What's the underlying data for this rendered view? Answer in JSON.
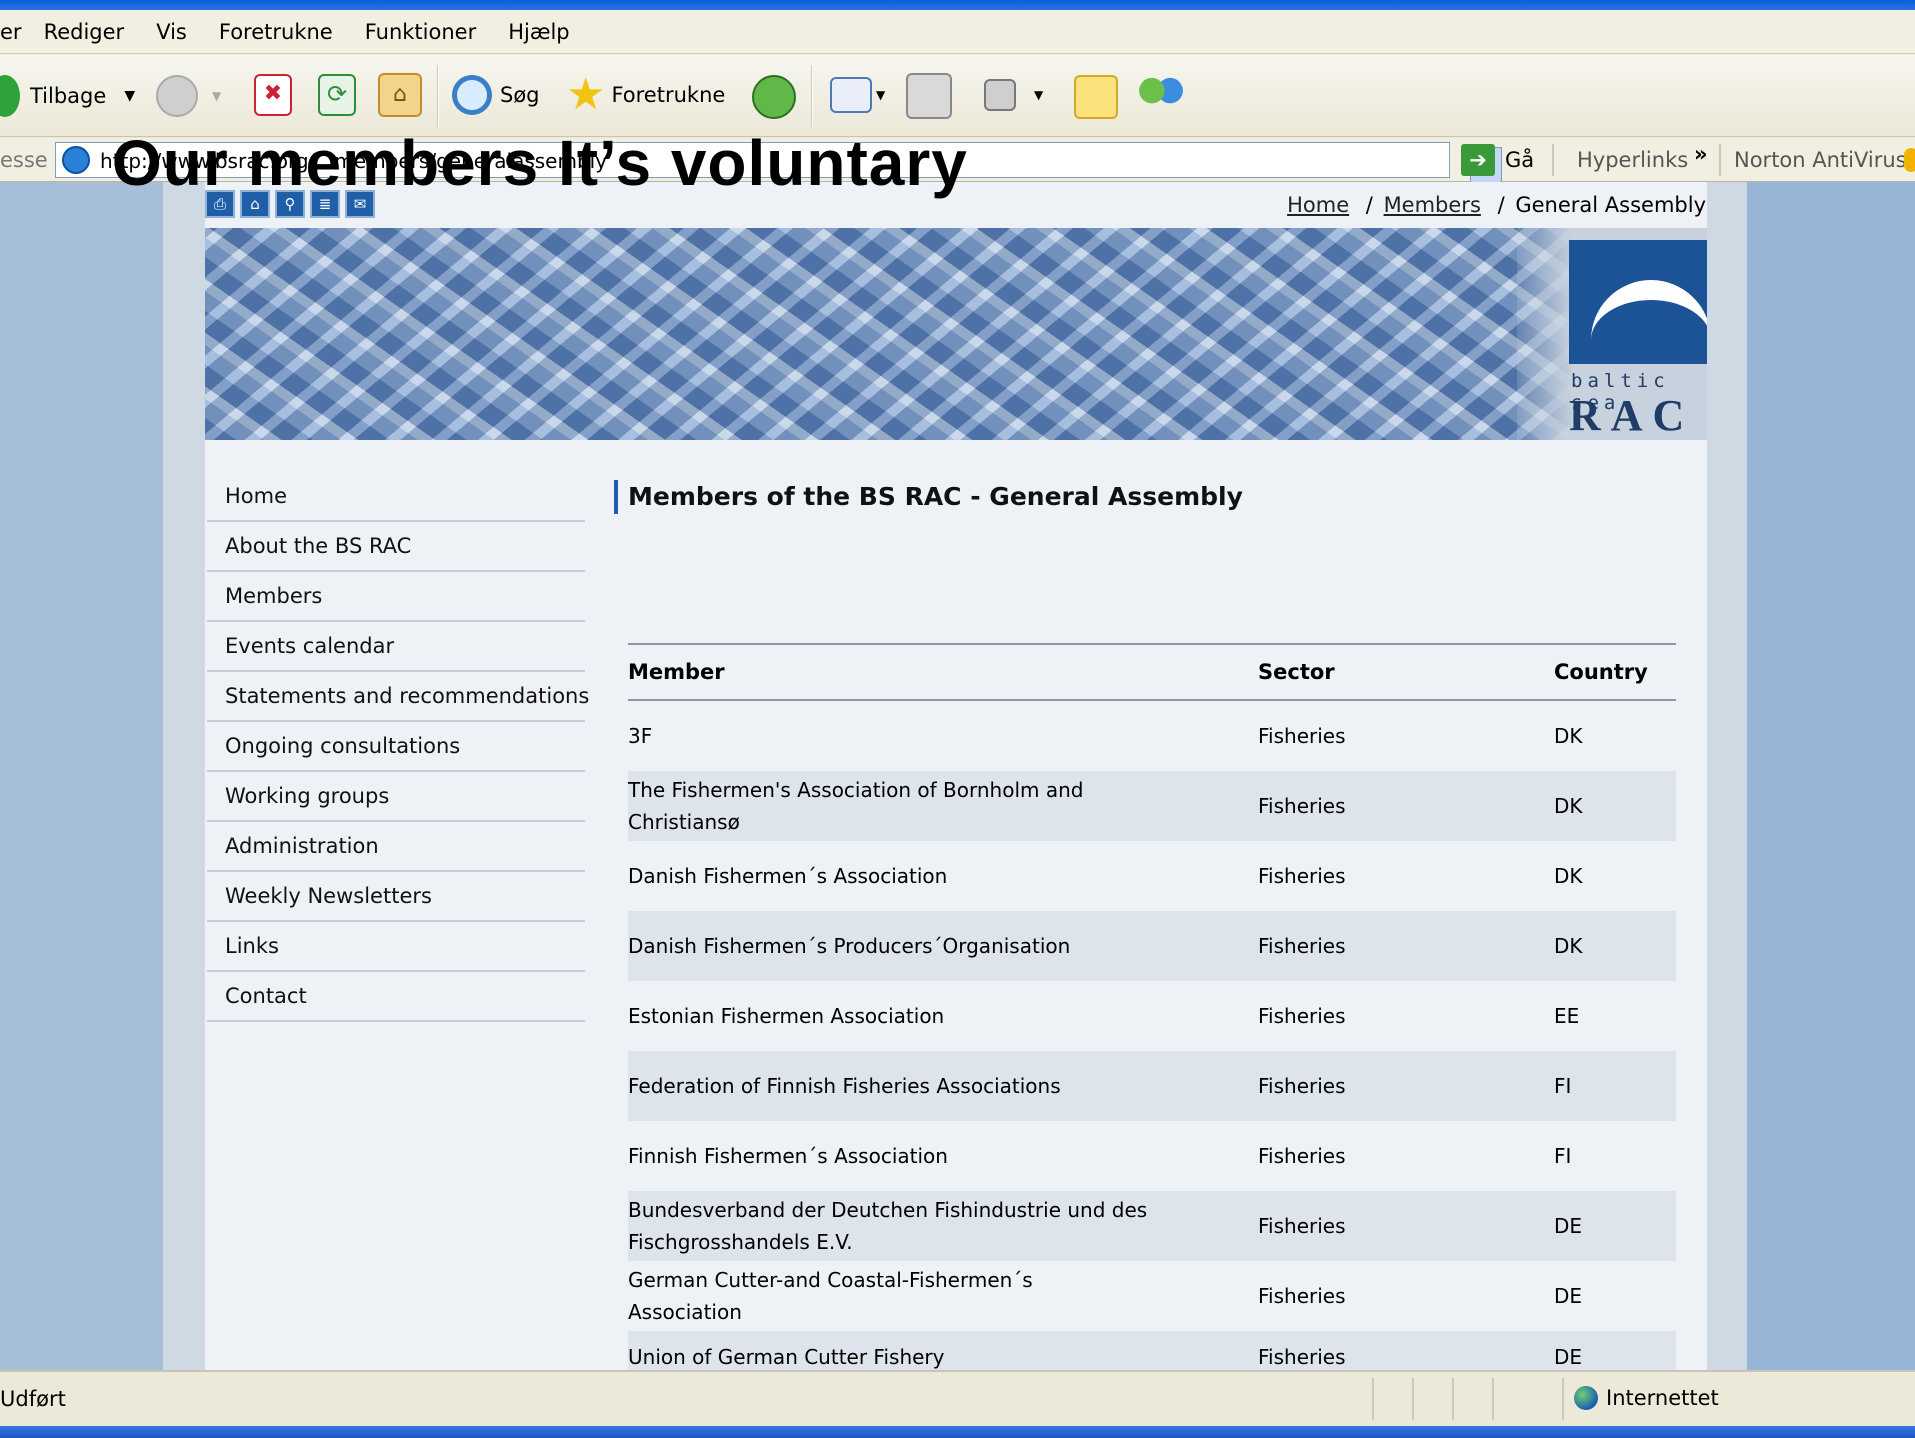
{
  "menubar": {
    "items": [
      "er",
      "Rediger",
      "Vis",
      "Foretrukne",
      "Funktioner",
      "Hjælp"
    ]
  },
  "toolbar": {
    "back_label": "Tilbage",
    "search_label": "Søg",
    "favorites_label": "Foretrukne"
  },
  "addressbar": {
    "label": "esse",
    "url": "http://www.bsrac.org/...members/generalassembly",
    "go_label": "Gå",
    "links_label": "Hyperlinks",
    "antivirus_label": "Norton AntiVirus"
  },
  "slide": {
    "title": "Our members  It’s voluntary"
  },
  "page": {
    "breadcrumb": {
      "home": "Home",
      "sep": "/",
      "members": "Members",
      "current": "General Assembly"
    },
    "logo": {
      "line1": "baltic sea",
      "line2": "RAC"
    },
    "nav": [
      "Home",
      "About the BS RAC",
      "Members",
      "Events calendar",
      "Statements and recommendations",
      "Ongoing consultations",
      "Working groups",
      "Administration",
      "Weekly Newsletters",
      "Links",
      "Contact"
    ],
    "title": "Members of the BS RAC - General Assembly",
    "table": {
      "headers": [
        "Member",
        "Sector",
        "Country"
      ],
      "rows": [
        [
          "3F",
          "Fisheries",
          "DK"
        ],
        [
          "The Fishermen's Association of Bornholm and Christiansø",
          "Fisheries",
          "DK"
        ],
        [
          "Danish Fishermen´s Association",
          "Fisheries",
          "DK"
        ],
        [
          "Danish Fishermen´s Producers´Organisation",
          "Fisheries",
          "DK"
        ],
        [
          "Estonian Fishermen Association",
          "Fisheries",
          "EE"
        ],
        [
          "Federation of Finnish Fisheries Associations",
          "Fisheries",
          "FI"
        ],
        [
          "Finnish Fishermen´s Association",
          "Fisheries",
          "FI"
        ],
        [
          "Bundesverband der Deutchen Fishindustrie und des Fischgrosshandels E.V.",
          "Fisheries",
          "DE"
        ],
        [
          "German Cutter-and Coastal-Fishermen´s Association",
          "Fisheries",
          "DE"
        ],
        [
          "Union of German Cutter Fishery",
          "Fisheries",
          "DE"
        ]
      ]
    }
  },
  "statusbar": {
    "status": "Udført",
    "zone": "Internettet"
  },
  "colors": {
    "accent": "#1f5fa8",
    "viewport_bg": "#97b5d4",
    "row_alt": "#dde4ec"
  }
}
